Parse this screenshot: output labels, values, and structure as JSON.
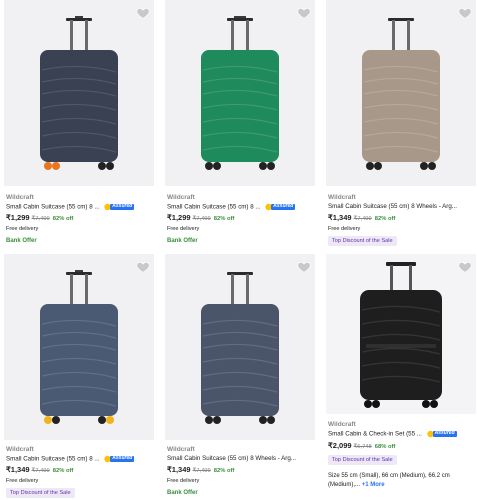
{
  "colors": {
    "navy": "#3a4152",
    "green": "#1f8a5c",
    "taupe": "#a8988a",
    "blue_grey": "#4a5a72",
    "slate": "#4b556a",
    "black": "#1e1e1f",
    "assured_blue": "#2874f0",
    "assured_gold": "#ffc200",
    "offer_green": "#388e3c",
    "badge_purple": "#5e35b1"
  },
  "products": [
    {
      "brand": "Wildcraft",
      "title": "Small Cabin Suitcase (55 cm) 8 ...",
      "assured": true,
      "assured_label": "Assured",
      "price": "₹1,299",
      "mrp": "₹7,499",
      "discount": "82% off",
      "delivery": "Free delivery",
      "offer": "Bank Offer",
      "color": "navy",
      "wheel_accent": "orange"
    },
    {
      "brand": "Wildcraft",
      "title": "Small Cabin Suitcase (55 cm) 8 ...",
      "assured": true,
      "assured_label": "Assured",
      "price": "₹1,299",
      "mrp": "₹7,499",
      "discount": "82% off",
      "delivery": "Free delivery",
      "offer": "Bank Offer",
      "color": "green",
      "wheel_accent": "none"
    },
    {
      "brand": "Wildcraft",
      "title": "Small Cabin Suitcase (55 cm) 8 Wheels - Arg...",
      "assured": false,
      "price": "₹1,349",
      "mrp": "₹7,499",
      "discount": "82% off",
      "delivery": "Free delivery",
      "badge": "Top Discount of the Sale",
      "color": "taupe",
      "wheel_accent": "none"
    },
    {
      "brand": "Wildcraft",
      "title": "Small Cabin Suitcase (55 cm) 8 ...",
      "assured": true,
      "assured_label": "Assured",
      "price": "₹1,349",
      "mrp": "₹7,499",
      "discount": "82% off",
      "delivery": "Free delivery",
      "badge": "Top Discount of the Sale",
      "color": "blue_grey",
      "wheel_accent": "yellow"
    },
    {
      "brand": "Wildcraft",
      "title": "Small Cabin Suitcase (55 cm) 8 Wheels - Arg...",
      "assured": false,
      "price": "₹1,349",
      "mrp": "₹7,499",
      "discount": "82% off",
      "delivery": "Free delivery",
      "offer": "Bank Offer",
      "color": "slate",
      "wheel_accent": "none"
    },
    {
      "brand": "Wildcraft",
      "title": "Small Cabin & Check-in Set (55 ...",
      "assured": true,
      "assured_label": "Assured",
      "price": "₹2,099",
      "mrp": "₹6,748",
      "discount": "68% off",
      "badge": "Top Discount of the Sale",
      "sizes": "Size 55 cm (Small), 66 cm (Medium), 66.2 cm (Medium),...",
      "more": "+1 More",
      "color": "black",
      "wheel_accent": "none"
    }
  ]
}
